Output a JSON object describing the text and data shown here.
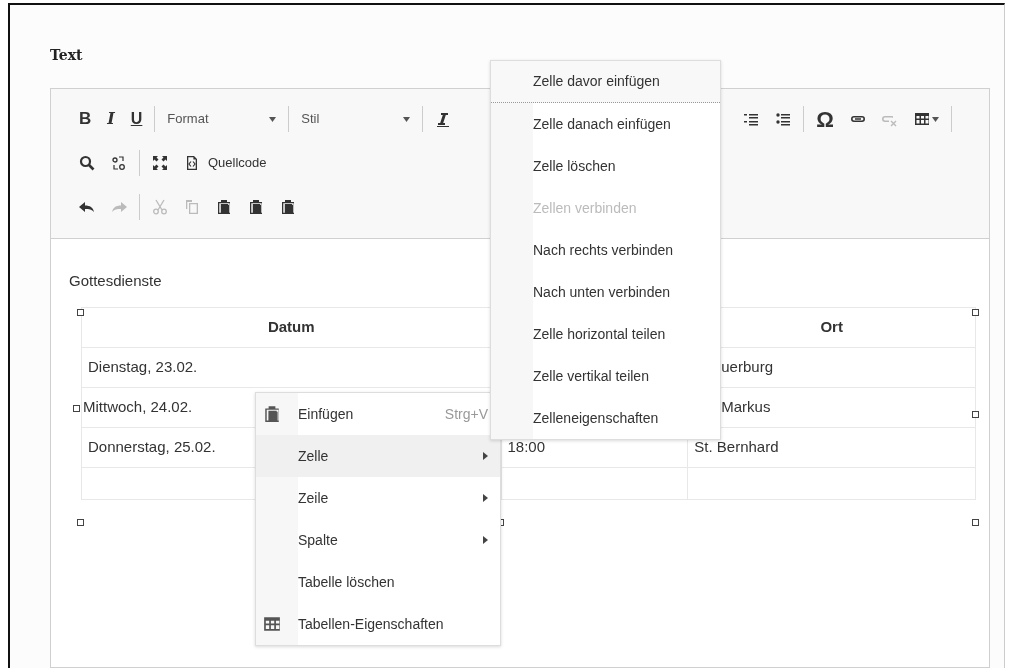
{
  "field_label": "Text",
  "toolbar": [
    [
      {
        "kind": "bold",
        "text": "B"
      },
      {
        "kind": "italic",
        "text": "I"
      },
      {
        "kind": "underline",
        "text": "U"
      },
      {
        "kind": "separator"
      },
      {
        "kind": "dropdown",
        "text": "Format"
      },
      {
        "kind": "separator"
      },
      {
        "kind": "dropdown",
        "text": "Stil"
      },
      {
        "kind": "separator"
      },
      {
        "kind": "clearformat"
      },
      {
        "kind": "gap"
      },
      {
        "kind": "numlist"
      },
      {
        "kind": "bullist"
      },
      {
        "kind": "separator"
      },
      {
        "kind": "glyph",
        "text": "Ω"
      },
      {
        "kind": "link"
      },
      {
        "kind": "unlink",
        "disabled": true
      },
      {
        "kind": "table"
      },
      {
        "kind": "separator"
      }
    ],
    [
      {
        "kind": "search"
      },
      {
        "kind": "replace"
      },
      {
        "kind": "separator"
      },
      {
        "kind": "maximize"
      },
      {
        "kind": "source",
        "text": "Quellcode"
      }
    ],
    [
      {
        "kind": "undo"
      },
      {
        "kind": "redo",
        "disabled": true
      },
      {
        "kind": "separator"
      },
      {
        "kind": "cut",
        "disabled": true
      },
      {
        "kind": "copy",
        "disabled": true
      },
      {
        "kind": "paste"
      },
      {
        "kind": "pastetext"
      },
      {
        "kind": "pasteword"
      }
    ]
  ],
  "content": {
    "heading": "Gottesdienste",
    "table": {
      "columns": [
        "Datum",
        null,
        "Ort"
      ],
      "rows": [
        [
          {
            "text": "Dienstag, 23.02."
          },
          null,
          {
            "text": "uerburg",
            "clipped": true
          }
        ],
        [
          {
            "text": "Mittwoch, 24.02.",
            "handle": true
          },
          null,
          {
            "text": "Markus",
            "clipped": true
          }
        ],
        [
          {
            "text": "Donnerstag, 25.02."
          },
          {
            "text": "18:00"
          },
          {
            "text": "St. Bernhard"
          }
        ],
        [
          null,
          null,
          null
        ]
      ]
    }
  },
  "context_menu": [
    {
      "kind": "paste",
      "label": "Einfügen",
      "shortcut": "Strg+V",
      "selected": false
    },
    {
      "kind": "submenu",
      "label": "Zelle",
      "selected": true
    },
    {
      "kind": "submenu",
      "label": "Zeile",
      "selected": false
    },
    {
      "kind": "submenu",
      "label": "Spalte",
      "selected": false
    },
    {
      "kind": "plain",
      "label": "Tabelle löschen",
      "selected": false
    },
    {
      "kind": "tableprops",
      "label": "Tabellen-Eigenschaften",
      "selected": false
    }
  ],
  "submenu": [
    {
      "label": "Zelle davor einfügen",
      "selected": true,
      "disabled": false
    },
    {
      "label": "Zelle danach einfügen",
      "selected": false,
      "disabled": false
    },
    {
      "label": "Zelle löschen",
      "selected": false,
      "disabled": false
    },
    {
      "label": "Zellen verbinden",
      "selected": false,
      "disabled": true
    },
    {
      "label": "Nach rechts verbinden",
      "selected": false,
      "disabled": false
    },
    {
      "label": "Nach unten verbinden",
      "selected": false,
      "disabled": false
    },
    {
      "label": "Zelle horizontal teilen",
      "selected": false,
      "disabled": false
    },
    {
      "label": "Zelle vertikal teilen",
      "selected": false,
      "disabled": false
    },
    {
      "label": "Zelleneigenschaften",
      "selected": false,
      "disabled": false
    }
  ]
}
